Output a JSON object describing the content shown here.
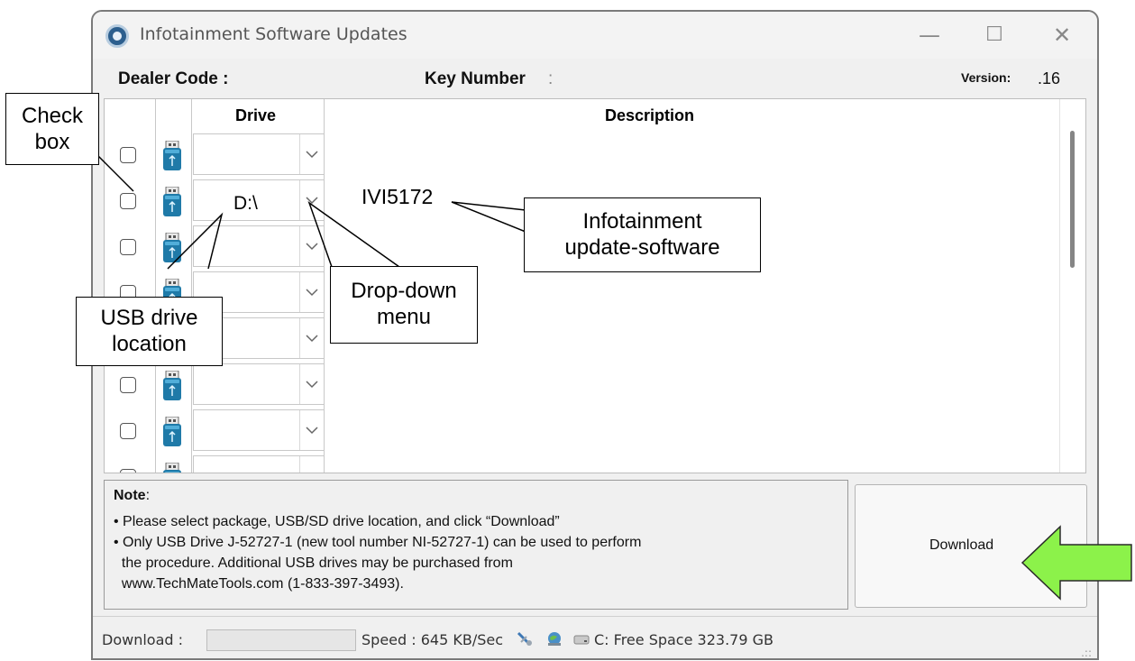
{
  "window": {
    "title": "Infotainment Software Updates",
    "controls": {
      "minimize": "—",
      "maximize": "☐",
      "close": "✕"
    }
  },
  "info_bar": {
    "dealer_code_label": "Dealer Code :",
    "key_number_label": "Key Number",
    "key_number_colon": ":",
    "version_label": "Version:",
    "version_value": ".16"
  },
  "grid": {
    "columns": [
      "",
      "",
      "Drive",
      "Description"
    ],
    "rows": [
      {
        "checked": false,
        "drive": "",
        "description": ""
      },
      {
        "checked": false,
        "drive": "D:\\",
        "description": "IVI5172"
      },
      {
        "checked": false,
        "drive": "",
        "description": ""
      },
      {
        "checked": false,
        "drive": "",
        "description": ""
      },
      {
        "checked": false,
        "drive": "",
        "description": ""
      },
      {
        "checked": false,
        "drive": "",
        "description": ""
      },
      {
        "checked": false,
        "drive": "",
        "description": ""
      },
      {
        "checked": false,
        "drive": "",
        "description": ""
      }
    ]
  },
  "note": {
    "title": "Note",
    "title_colon": ":",
    "lines": [
      "• Please select package, USB/SD drive location, and click “Download”",
      "• Only USB Drive J-52727-1 (new tool number NI-52727-1) can be used to perform",
      "  the procedure. Additional USB drives may be purchased from",
      "  www.TechMateTools.com (1-833-397-3493)."
    ]
  },
  "download_button": {
    "label": "Download"
  },
  "status_bar": {
    "download_label": "Download :",
    "speed": "Speed :  645 KB/Sec",
    "free_space": "C: Free Space 323.79 GB"
  },
  "annotations": {
    "check_box": [
      "Check",
      "box"
    ],
    "usb_drive_location": [
      "USB drive",
      "location"
    ],
    "drop_down_menu": [
      "Drop-down",
      "menu"
    ],
    "infotainment_software": [
      "Infotainment",
      "update-software"
    ]
  },
  "colors": {
    "accent_arrow": "#8cf24a",
    "usb_icon": "#1f7aa8",
    "window_bg": "#f0f0f0"
  },
  "icons": [
    "app-icon",
    "usb-icon",
    "chevron-down-icon",
    "network-icon",
    "globe-icon",
    "drive-icon",
    "resize-grip-icon"
  ]
}
